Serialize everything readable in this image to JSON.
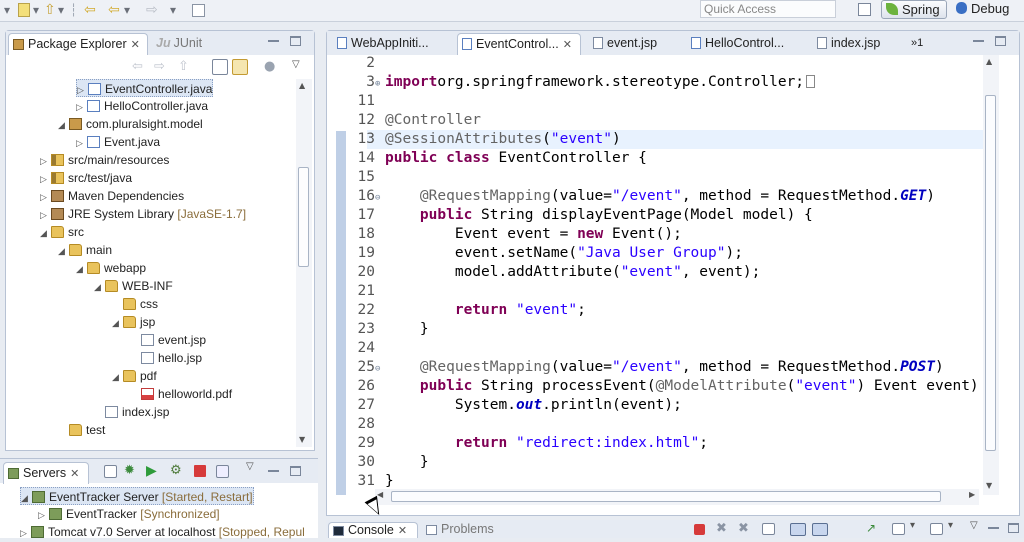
{
  "toolbar": {
    "quick_access_placeholder": "Quick Access"
  },
  "perspectives": [
    {
      "label": "Spring",
      "active": true
    },
    {
      "label": "Debug",
      "active": false
    }
  ],
  "package_explorer": {
    "tabs": [
      {
        "label": "Package Explorer",
        "active": true
      },
      {
        "label": "JUnit",
        "active": false
      }
    ],
    "tree": [
      {
        "label": "EventController.java",
        "icon": "java-file-icon",
        "depth": 4,
        "twisty": "collapsed",
        "selected": true
      },
      {
        "label": "HelloController.java",
        "icon": "java-file-icon",
        "depth": 4,
        "twisty": "collapsed"
      },
      {
        "label": "com.pluralsight.model",
        "icon": "package-icon",
        "depth": 3,
        "twisty": "expanded"
      },
      {
        "label": "Event.java",
        "icon": "java-file-icon",
        "depth": 4,
        "twisty": "collapsed"
      },
      {
        "label": "src/main/resources",
        "icon": "source-folder-icon",
        "depth": 2,
        "twisty": "collapsed"
      },
      {
        "label": "src/test/java",
        "icon": "source-folder-icon",
        "depth": 2,
        "twisty": "collapsed"
      },
      {
        "label": "Maven Dependencies",
        "icon": "library-icon",
        "depth": 2,
        "twisty": "collapsed"
      },
      {
        "label": "JRE System Library",
        "suffix": "[JavaSE-1.7]",
        "icon": "library-icon",
        "depth": 2,
        "twisty": "collapsed"
      },
      {
        "label": "src",
        "icon": "folder-icon",
        "depth": 2,
        "twisty": "expanded"
      },
      {
        "label": "main",
        "icon": "folder-icon",
        "depth": 3,
        "twisty": "expanded"
      },
      {
        "label": "webapp",
        "icon": "folder-icon",
        "depth": 4,
        "twisty": "expanded"
      },
      {
        "label": "WEB-INF",
        "icon": "folder-icon",
        "depth": 5,
        "twisty": "expanded"
      },
      {
        "label": "css",
        "icon": "folder-icon",
        "depth": 6,
        "twisty": "none"
      },
      {
        "label": "jsp",
        "icon": "folder-icon",
        "depth": 6,
        "twisty": "expanded"
      },
      {
        "label": "event.jsp",
        "icon": "jsp-file-icon",
        "depth": 7,
        "twisty": "none"
      },
      {
        "label": "hello.jsp",
        "icon": "jsp-file-icon",
        "depth": 7,
        "twisty": "none"
      },
      {
        "label": "pdf",
        "icon": "folder-icon",
        "depth": 6,
        "twisty": "expanded"
      },
      {
        "label": "helloworld.pdf",
        "icon": "pdf-file-icon",
        "depth": 7,
        "twisty": "none"
      },
      {
        "label": "index.jsp",
        "icon": "jsp-file-icon",
        "depth": 5,
        "twisty": "none"
      },
      {
        "label": "test",
        "icon": "folder-icon",
        "depth": 3,
        "twisty": "none"
      }
    ]
  },
  "servers": {
    "tab_label": "Servers",
    "rows": [
      {
        "label": "EventTracker Server",
        "state": "[Started, Restart]",
        "depth": 0,
        "twisty": "expanded",
        "selected": true
      },
      {
        "label": "EventTracker",
        "state": "[Synchronized]",
        "depth": 1,
        "twisty": "collapsed"
      },
      {
        "label": "Tomcat v7.0 Server at localhost",
        "state": "[Stopped, Repul",
        "depth": 0,
        "twisty": "collapsed"
      }
    ]
  },
  "editor": {
    "tabs": [
      {
        "label": "WebAppIniti...",
        "active": false
      },
      {
        "label": "EventControl...",
        "active": true
      },
      {
        "label": "event.jsp",
        "active": false
      },
      {
        "label": "HelloControl...",
        "active": false
      },
      {
        "label": "index.jsp",
        "active": false
      }
    ],
    "overflow_label": "»1",
    "lines": [
      {
        "n": "2",
        "code": "",
        "fold": ""
      },
      {
        "n": "3",
        "code": "import org.springframework.stereotype.Controller;",
        "fold": "+",
        "tokens": [
          [
            "kw",
            "import"
          ],
          [
            "",
            "org.springframework.stereotype.Controller;"
          ]
        ]
      },
      {
        "n": "11",
        "code": "",
        "fold": ""
      },
      {
        "n": "12",
        "code": "@Controller",
        "fold": "",
        "tokens": [
          [
            "ann",
            "@Controller"
          ]
        ]
      },
      {
        "n": "13",
        "code": "@SessionAttributes(\"event\")",
        "fold": "",
        "highlight": true,
        "tokens": [
          [
            "ann",
            "@SessionAttributes"
          ],
          [
            "",
            "("
          ],
          [
            "str",
            "\"event\""
          ],
          [
            "",
            ")"
          ]
        ]
      },
      {
        "n": "14",
        "code": "public class EventController {",
        "fold": "",
        "tokens": [
          [
            "kw",
            "public"
          ],
          [
            "",
            " "
          ],
          [
            "kw",
            "class"
          ],
          [
            "",
            " EventController {"
          ]
        ]
      },
      {
        "n": "15",
        "code": "",
        "fold": ""
      },
      {
        "n": "16",
        "code": "    @RequestMapping(value=\"/event\", method = RequestMethod.GET)",
        "fold": "-",
        "tokens": [
          [
            "",
            "    "
          ],
          [
            "ann",
            "@RequestMapping"
          ],
          [
            "",
            "(value="
          ],
          [
            "str",
            "\"/event\""
          ],
          [
            "",
            ", method = RequestMethod."
          ],
          [
            "it",
            "GET"
          ],
          [
            "",
            ")"
          ]
        ]
      },
      {
        "n": "17",
        "code": "    public String displayEventPage(Model model) {",
        "fold": "",
        "tokens": [
          [
            "",
            "    "
          ],
          [
            "kw",
            "public"
          ],
          [
            "",
            " String displayEventPage(Model model) {"
          ]
        ]
      },
      {
        "n": "18",
        "code": "        Event event = new Event();",
        "fold": "",
        "tokens": [
          [
            "",
            "        Event event = "
          ],
          [
            "kw",
            "new"
          ],
          [
            "",
            " Event();"
          ]
        ]
      },
      {
        "n": "19",
        "code": "        event.setName(\"Java User Group\");",
        "fold": "",
        "tokens": [
          [
            "",
            "        event.setName("
          ],
          [
            "str",
            "\"Java User Group\""
          ],
          [
            "",
            ");"
          ]
        ]
      },
      {
        "n": "20",
        "code": "        model.addAttribute(\"event\", event);",
        "fold": "",
        "tokens": [
          [
            "",
            "        model.addAttribute("
          ],
          [
            "str",
            "\"event\""
          ],
          [
            "",
            ", event);"
          ]
        ]
      },
      {
        "n": "21",
        "code": "",
        "fold": ""
      },
      {
        "n": "22",
        "code": "        return \"event\";",
        "fold": "",
        "tokens": [
          [
            "",
            "        "
          ],
          [
            "kw",
            "return"
          ],
          [
            "",
            " "
          ],
          [
            "str",
            "\"event\""
          ],
          [
            "",
            ";"
          ]
        ]
      },
      {
        "n": "23",
        "code": "    }",
        "fold": "",
        "tokens": [
          [
            "",
            "    }"
          ]
        ]
      },
      {
        "n": "24",
        "code": "",
        "fold": ""
      },
      {
        "n": "25",
        "code": "    @RequestMapping(value=\"/event\", method = RequestMethod.POST)",
        "fold": "-",
        "tokens": [
          [
            "",
            "    "
          ],
          [
            "ann",
            "@RequestMapping"
          ],
          [
            "",
            "(value="
          ],
          [
            "str",
            "\"/event\""
          ],
          [
            "",
            ", method = RequestMethod."
          ],
          [
            "it",
            "POST"
          ],
          [
            "",
            ")"
          ]
        ]
      },
      {
        "n": "26",
        "code": "    public String processEvent(@ModelAttribute(\"event\") Event event)",
        "fold": "",
        "tokens": [
          [
            "",
            "    "
          ],
          [
            "kw",
            "public"
          ],
          [
            "",
            " String processEvent("
          ],
          [
            "ann",
            "@ModelAttribute"
          ],
          [
            "",
            "("
          ],
          [
            "str",
            "\"event\""
          ],
          [
            "",
            ") Event event)"
          ]
        ]
      },
      {
        "n": "27",
        "code": "        System.out.println(event);",
        "fold": "",
        "tokens": [
          [
            "",
            "        System."
          ],
          [
            "fld",
            "out"
          ],
          [
            "",
            ".println(event);"
          ]
        ]
      },
      {
        "n": "28",
        "code": "",
        "fold": ""
      },
      {
        "n": "29",
        "code": "        return \"redirect:index.html\";",
        "fold": "",
        "tokens": [
          [
            "",
            "        "
          ],
          [
            "kw",
            "return"
          ],
          [
            "",
            " "
          ],
          [
            "str",
            "\"redirect:index.html\""
          ],
          [
            "",
            ";"
          ]
        ]
      },
      {
        "n": "30",
        "code": "    }",
        "fold": "",
        "tokens": [
          [
            "",
            "    }"
          ]
        ]
      },
      {
        "n": "31",
        "code": "}",
        "fold": "",
        "tokens": [
          [
            "",
            "}"
          ]
        ]
      }
    ]
  },
  "bottom_tabs": [
    {
      "label": "Console",
      "active": true
    },
    {
      "label": "Problems",
      "active": false
    }
  ],
  "colors": {
    "keyword": "#7f0055",
    "annotation": "#646464",
    "string": "#2a00ff",
    "static_field": "#0000c0",
    "current_line": "#e8f2fe"
  }
}
